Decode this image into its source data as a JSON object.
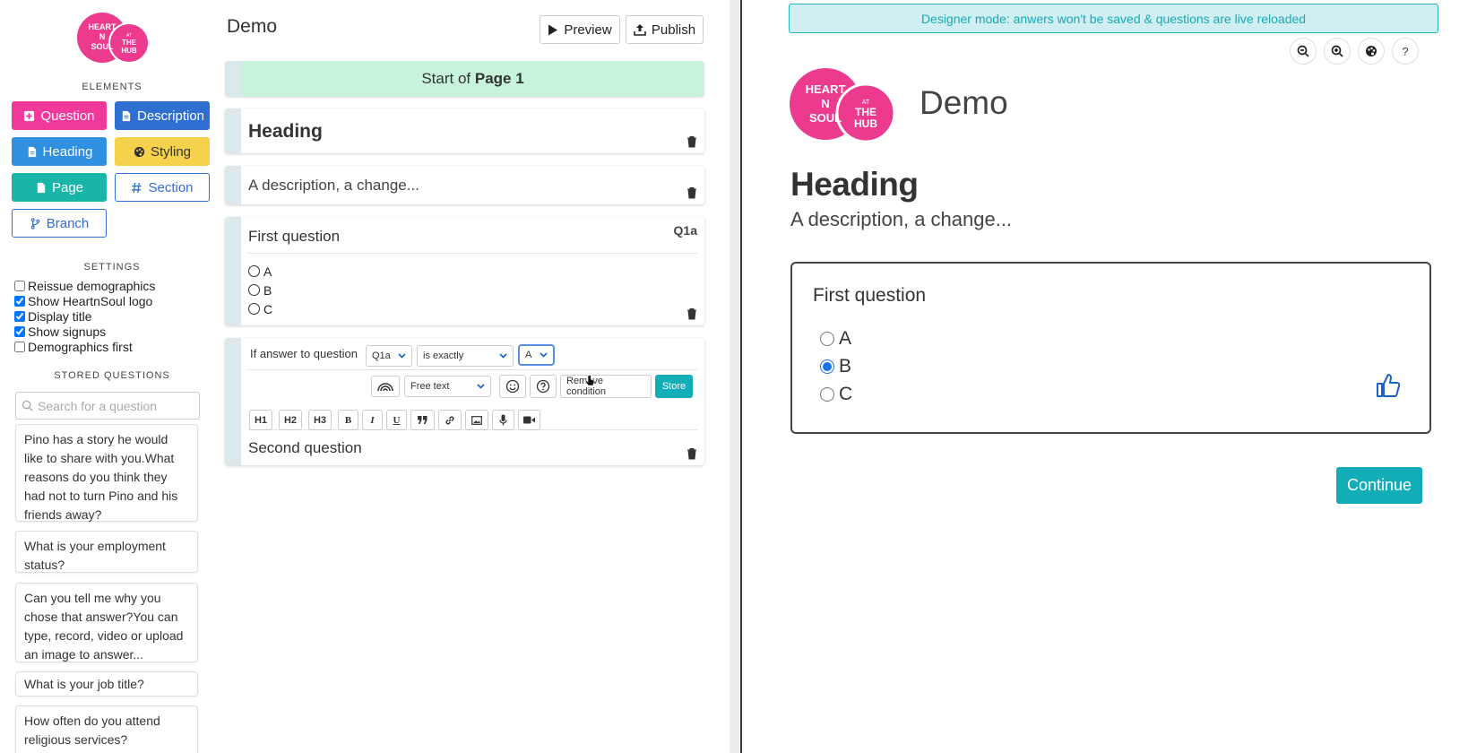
{
  "logo": {
    "line1": "HEART",
    "line2": "N",
    "line3": "SOUL",
    "at": "AT",
    "the": "THE",
    "hub": "HUB"
  },
  "sidebar": {
    "elements_label": "ELEMENTS",
    "buttons": {
      "question": "Question",
      "description": "Description",
      "heading": "Heading",
      "styling": "Styling",
      "page": "Page",
      "section": "Section",
      "branch": "Branch"
    },
    "settings_label": "SETTINGS",
    "settings": [
      {
        "label": "Reissue demographics",
        "checked": false
      },
      {
        "label": "Show HeartnSoul logo",
        "checked": true
      },
      {
        "label": "Display title",
        "checked": true
      },
      {
        "label": "Show signups",
        "checked": true
      },
      {
        "label": "Demographics first",
        "checked": false
      }
    ],
    "stored_label": "STORED QUESTIONS",
    "search_placeholder": "Search for a question",
    "stored": [
      "Pino has a story he would like to share with you.What reasons do you think they had not to turn Pino and his friends away?",
      "What is your employment status?",
      "Can you tell me why you chose that answer?You can type, record, video or upload an image to answer...",
      "What is your job title?",
      "How often do you attend religious services?"
    ]
  },
  "designer": {
    "title": "Demo",
    "preview_label": "Preview",
    "publish_label": "Publish",
    "page_start_prefix": "Start of ",
    "page_start_name": "Page 1",
    "heading": "Heading",
    "description": "A description, a change...",
    "question1": {
      "text": "First question",
      "id": "Q1a",
      "options": [
        "A",
        "B",
        "C"
      ]
    },
    "condition": {
      "label": "If answer to question",
      "question_select": "Q1a",
      "operator_select": "is exactly",
      "value_select": "A",
      "type_select": "Free text",
      "remove_label": "Remove condition",
      "store_label": "Store"
    },
    "format": [
      "H1",
      "H2",
      "H3",
      "B",
      "I",
      "U"
    ],
    "question2": "Second question"
  },
  "preview": {
    "banner": "Designer mode: anwers won't be saved & questions are live reloaded",
    "help": "?",
    "title": "Demo",
    "heading": "Heading",
    "description": "A description, a change...",
    "question": "First question",
    "options": [
      "A",
      "B",
      "C"
    ],
    "selected": "B",
    "continue_label": "Continue"
  },
  "colors": {
    "question": "#f0399a",
    "description": "#2f6fd1",
    "heading": "#2f8fe0",
    "styling": "#f6d14b",
    "page": "#19b5a9",
    "accent": "#13adb8",
    "page_banner": "#c6f3da"
  }
}
